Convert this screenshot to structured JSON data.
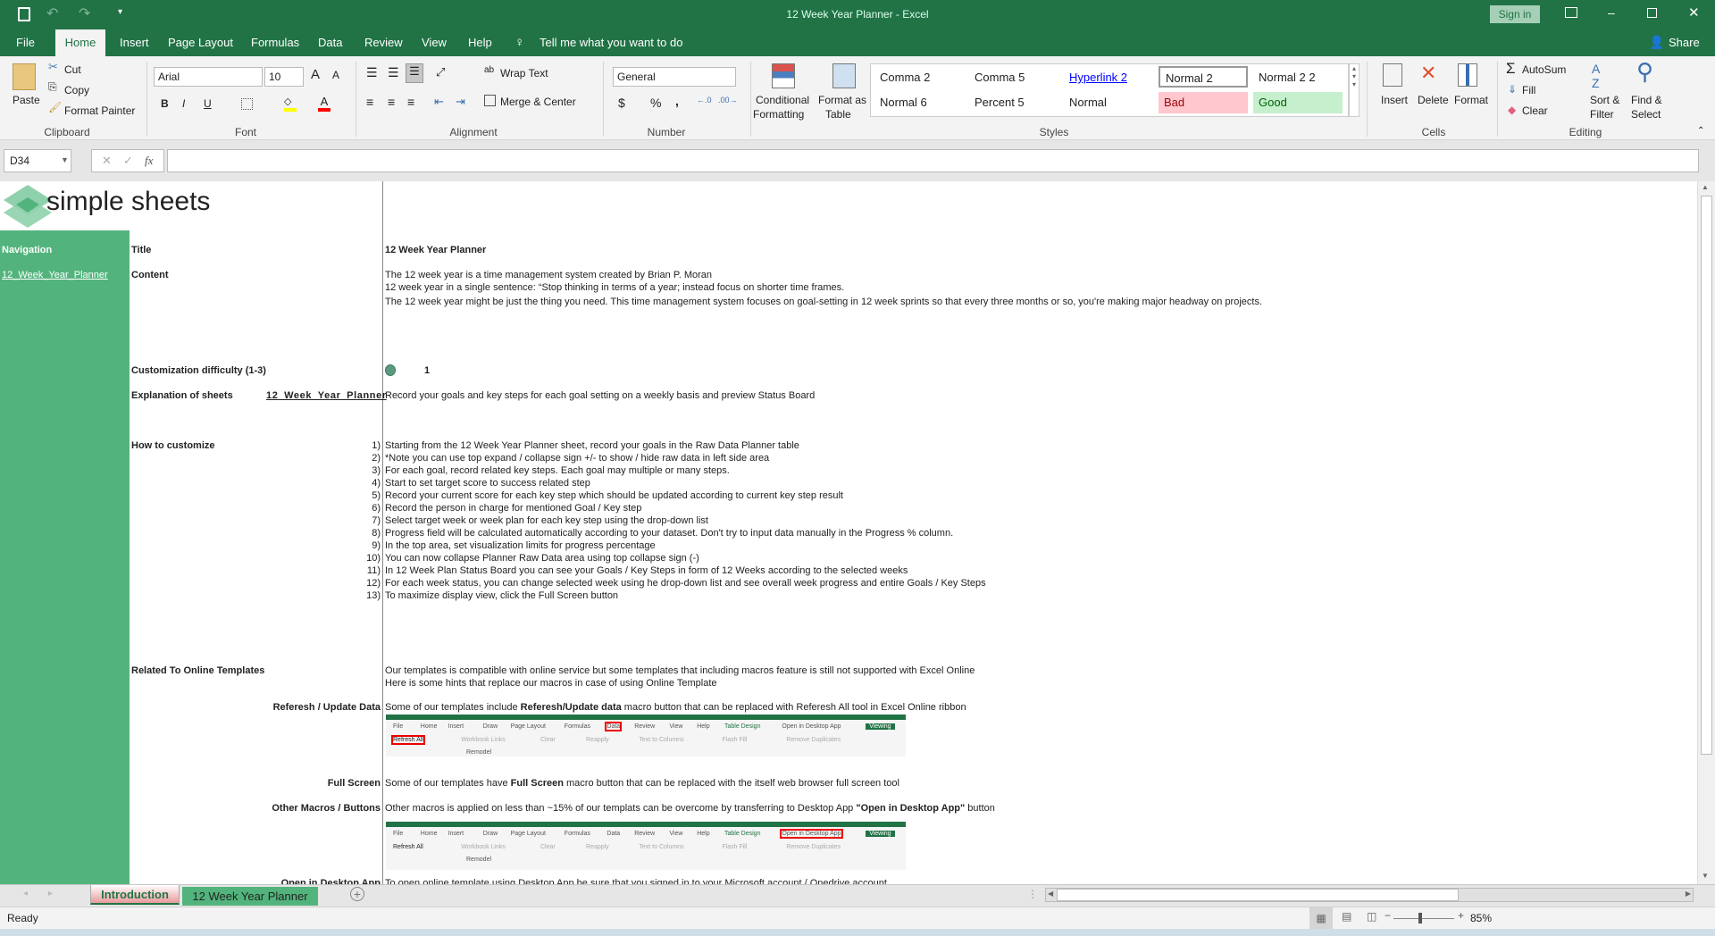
{
  "window": {
    "title": "12 Week Year Planner  -  Excel",
    "sign_in": "Sign in",
    "share": "Share"
  },
  "menu_tabs": [
    "File",
    "Home",
    "Insert",
    "Page Layout",
    "Formulas",
    "Data",
    "Review",
    "View",
    "Help"
  ],
  "tell_me": "Tell me what you want to do",
  "clipboard": {
    "paste": "Paste",
    "cut": "Cut",
    "copy": "Copy",
    "format_painter": "Format Painter",
    "label": "Clipboard"
  },
  "font": {
    "name": "Arial",
    "size": "10",
    "label": "Font",
    "bold": "B",
    "italic": "I",
    "underline": "U"
  },
  "alignment": {
    "wrap": "Wrap Text",
    "merge": "Merge & Center",
    "label": "Alignment"
  },
  "number": {
    "format": "General",
    "currency": "$",
    "percent": "%",
    "comma": ",",
    "label": "Number"
  },
  "styles": {
    "conditional": "Conditional",
    "conditional2": "Formatting",
    "format_as": "Format as",
    "format_as2": "Table",
    "label": "Styles",
    "cells": [
      "Comma 2",
      "Comma 5",
      "Hyperlink 2",
      "Normal 2",
      "Normal 2 2",
      "Normal 6",
      "Percent 5",
      "Normal",
      "Bad",
      "Good"
    ]
  },
  "cells_group": {
    "insert": "Insert",
    "delete": "Delete",
    "format": "Format",
    "label": "Cells"
  },
  "editing": {
    "autosum": "AutoSum",
    "fill": "Fill",
    "clear": "Clear",
    "sort1": "Sort &",
    "sort2": "Filter",
    "find1": "Find &",
    "find2": "Select",
    "label": "Editing"
  },
  "formula_bar": {
    "name_box": "D34",
    "fx": "fx",
    "value": ""
  },
  "sheet": {
    "logo_text": "simple sheets",
    "nav_label": "Navigation",
    "nav_link": "12_Week_Year_Planner",
    "title_label": "Title",
    "title_value": "12 Week Year Planner",
    "content_label": "Content",
    "content_lines": [
      "The 12 week year is a time management system created by Brian P. Moran",
      "12 week year in a single sentence: “Stop thinking in terms of a year; instead focus on shorter time frames.",
      "The 12 week year might be just the thing you need. This time management system focuses on goal-setting in 12 week sprints so that every three months or so, you're making major headway on projects."
    ],
    "difficulty_label": "Customization difficulty (1-3)",
    "difficulty_value": "1",
    "explanation_label": "Explanation of sheets",
    "explanation_link": "12_Week_Year_Planner",
    "explanation_text": "Record your goals and key steps for each goal setting on a weekly basis and preview Status Board",
    "customize_label": "How to customize",
    "steps": [
      {
        "n": "1)",
        "t": "Starting from the 12 Week Year Planner sheet, record your goals in the Raw Data Planner table"
      },
      {
        "n": "2)",
        "t": "*Note you can use top expand / collapse sign +/- to show / hide raw data in left side area"
      },
      {
        "n": "3)",
        "t": "For each goal, record related key steps. Each goal may multiple or many steps."
      },
      {
        "n": "4)",
        "t": "Start to set target score to success related step"
      },
      {
        "n": "5)",
        "t": "Record your current score for each key step which should be updated according to current key step result"
      },
      {
        "n": "6)",
        "t": "Record the person in charge for mentioned Goal / Key step"
      },
      {
        "n": "7)",
        "t": "Select target week or week plan for each key step using the drop-down list"
      },
      {
        "n": "8)",
        "t": "Progress field will be calculated automatically according to your dataset. Don't try to input data manually in the Progress % column."
      },
      {
        "n": "9)",
        "t": "In the top area, set visualization limits for progress percentage"
      },
      {
        "n": "10)",
        "t": "You can now collapse Planner Raw Data area using top collapse sign (-)"
      },
      {
        "n": "11)",
        "t": "In 12 Week Plan Status Board you can see your Goals / Key Steps in form of 12 Weeks according to the selected weeks"
      },
      {
        "n": "12)",
        "t": "For each week status, you can change selected week using he drop-down list and see overall week progress and entire Goals / Key Steps"
      },
      {
        "n": "13)",
        "t": "To maximize display view, click the Full Screen button"
      }
    ],
    "online_label": "Related To Online Templates",
    "online_lines": [
      "Our templates is compatible with online service but some templates that including macros feature is still not supported with Excel Online",
      "Here is some hints that replace our macros in case of using Online Template"
    ],
    "refresh_label": "Referesh / Update Data",
    "refresh_pre": "Some of our templates include ",
    "refresh_bold": "Referesh/Update data",
    "refresh_post": " macro button that can be replaced with Referesh All tool in Excel Online ribbon",
    "fullscreen_label": "Full Screen",
    "fullscreen_pre": "Some of our templates have ",
    "fullscreen_bold": "Full Screen",
    "fullscreen_post": " macro button that can be replaced with the itself web browser full screen tool",
    "macros_label": "Other Macros / Buttons",
    "macros_pre": "Other macros is applied on less than ~15% of our templats can be overcome by transferring to Desktop App ",
    "macros_bold": "\"Open in Desktop App\"",
    "macros_post": " button",
    "desktop_label": "Open in Desktop App",
    "desktop_text": "To open online template using Desktop App be sure that you signed in to your Microsoft account / Onedrive account",
    "shot_menu": [
      "File",
      "Home",
      "Insert",
      "Draw",
      "Page Layout",
      "Formulas",
      "Data",
      "Review",
      "View",
      "Help",
      "Table Design",
      "Open in Desktop App",
      "Viewing"
    ],
    "shot_tools": [
      "Refresh All",
      "Workbook Links",
      "Clear",
      "Reapply",
      "Text to Columns",
      "Flash Fill",
      "Remove Duplicates"
    ],
    "shot_formula": "Remodel"
  },
  "sheet_tabs": [
    "Introduction",
    "12 Week Year Planner"
  ],
  "status": {
    "ready": "Ready",
    "zoom": "85%"
  },
  "colors": {
    "excel_green": "#217346",
    "nav_green": "#52b47c",
    "bad_bg": "#ffc7ce",
    "good_bg": "#c6efce"
  }
}
